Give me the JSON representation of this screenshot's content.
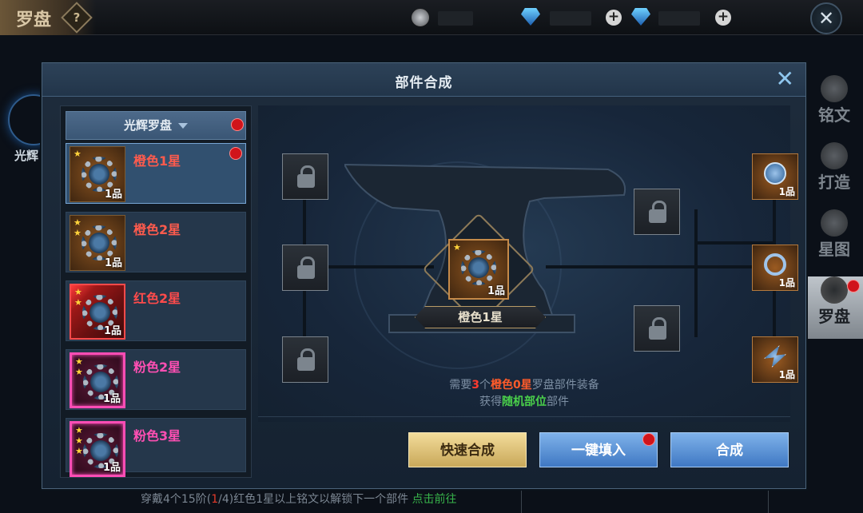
{
  "topbar": {
    "title": "罗盘",
    "help": "?",
    "close": "✕"
  },
  "left_hint": {
    "label": "光辉"
  },
  "right_tabs": [
    {
      "label": "铭文",
      "icon": "inscription-icon"
    },
    {
      "label": "打造",
      "icon": "forge-icon"
    },
    {
      "label": "星图",
      "icon": "star-map-icon"
    },
    {
      "label": "罗盘",
      "icon": "compass-icon",
      "active": true
    }
  ],
  "dialog": {
    "title": "部件合成",
    "close": "✕",
    "dropdown": "光辉罗盘",
    "items": [
      {
        "name": "橙色1星",
        "quality": "1品",
        "stars": 1,
        "frame": "orange",
        "color": "#ff5b4d",
        "selected": true
      },
      {
        "name": "橙色2星",
        "quality": "1品",
        "stars": 2,
        "frame": "orange",
        "color": "#ff5b4d"
      },
      {
        "name": "红色2星",
        "quality": "1品",
        "stars": 2,
        "frame": "red",
        "color": "#ff4b4b"
      },
      {
        "name": "粉色2星",
        "quality": "1品",
        "stars": 2,
        "frame": "pink",
        "color": "#ff4fb3"
      },
      {
        "name": "粉色3星",
        "quality": "1品",
        "stars": 3,
        "frame": "pink",
        "color": "#ff4fb3"
      }
    ],
    "center": {
      "name": "橙色1星",
      "quality": "1品"
    },
    "results": [
      {
        "quality": "1品"
      },
      {
        "quality": "1品"
      },
      {
        "quality": "1品"
      }
    ],
    "requirement": {
      "p1": "需要",
      "count": "3",
      "p2": "个",
      "item": "橙色0星",
      "p3": "罗盘部件装备",
      "p4": "获得",
      "reward": "随机部位",
      "p5": "部件"
    },
    "buttons": {
      "quick": "快速合成",
      "fill": "一键填入",
      "craft": "合成"
    }
  },
  "bottom_hint": {
    "a": "穿戴4个15阶(",
    "b": "1",
    "c": "/4)红色1星以上铭文以解锁下一个部件 ",
    "link": "点击前往"
  }
}
